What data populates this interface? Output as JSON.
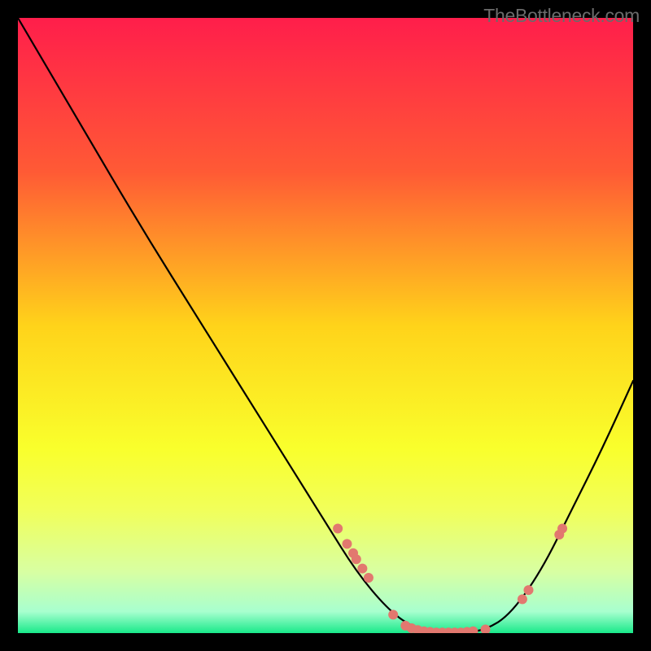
{
  "attribution": "TheBottleneck.com",
  "chart_data": {
    "type": "line",
    "title": "",
    "xlabel": "",
    "ylabel": "",
    "xlim": [
      0,
      100
    ],
    "ylim": [
      0,
      100
    ],
    "gradient_stops": [
      {
        "offset": 0.0,
        "color": "#ff1e4b"
      },
      {
        "offset": 0.25,
        "color": "#ff5a35"
      },
      {
        "offset": 0.5,
        "color": "#ffd31a"
      },
      {
        "offset": 0.7,
        "color": "#f9ff2c"
      },
      {
        "offset": 0.8,
        "color": "#f1ff5a"
      },
      {
        "offset": 0.9,
        "color": "#d8ffa2"
      },
      {
        "offset": 0.965,
        "color": "#a8ffcf"
      },
      {
        "offset": 1.0,
        "color": "#19e98a"
      }
    ],
    "curve": [
      {
        "x": 0.0,
        "y": 100.0
      },
      {
        "x": 10.0,
        "y": 83.0
      },
      {
        "x": 20.0,
        "y": 66.0
      },
      {
        "x": 30.0,
        "y": 50.0
      },
      {
        "x": 40.0,
        "y": 34.0
      },
      {
        "x": 50.0,
        "y": 18.0
      },
      {
        "x": 55.0,
        "y": 10.0
      },
      {
        "x": 60.0,
        "y": 4.0
      },
      {
        "x": 64.0,
        "y": 1.0
      },
      {
        "x": 68.0,
        "y": 0.0
      },
      {
        "x": 72.0,
        "y": 0.0
      },
      {
        "x": 76.0,
        "y": 0.5
      },
      {
        "x": 80.0,
        "y": 3.0
      },
      {
        "x": 85.0,
        "y": 10.0
      },
      {
        "x": 90.0,
        "y": 20.0
      },
      {
        "x": 95.0,
        "y": 30.0
      },
      {
        "x": 100.0,
        "y": 41.0
      }
    ],
    "scatter": [
      {
        "x": 52.0,
        "y": 17.0
      },
      {
        "x": 53.5,
        "y": 14.5
      },
      {
        "x": 54.5,
        "y": 13.0
      },
      {
        "x": 55.0,
        "y": 12.0
      },
      {
        "x": 56.0,
        "y": 10.5
      },
      {
        "x": 57.0,
        "y": 9.0
      },
      {
        "x": 61.0,
        "y": 3.0
      },
      {
        "x": 63.0,
        "y": 1.2
      },
      {
        "x": 64.0,
        "y": 0.8
      },
      {
        "x": 65.0,
        "y": 0.5
      },
      {
        "x": 66.0,
        "y": 0.3
      },
      {
        "x": 67.0,
        "y": 0.2
      },
      {
        "x": 68.0,
        "y": 0.1
      },
      {
        "x": 69.0,
        "y": 0.1
      },
      {
        "x": 70.0,
        "y": 0.1
      },
      {
        "x": 71.0,
        "y": 0.1
      },
      {
        "x": 72.0,
        "y": 0.1
      },
      {
        "x": 73.0,
        "y": 0.2
      },
      {
        "x": 74.0,
        "y": 0.3
      },
      {
        "x": 76.0,
        "y": 0.6
      },
      {
        "x": 82.0,
        "y": 5.5
      },
      {
        "x": 83.0,
        "y": 7.0
      },
      {
        "x": 88.0,
        "y": 16.0
      },
      {
        "x": 88.5,
        "y": 17.0
      }
    ],
    "scatter_color": "#e2786f",
    "curve_color": "#000000",
    "dot_radius": 6
  }
}
